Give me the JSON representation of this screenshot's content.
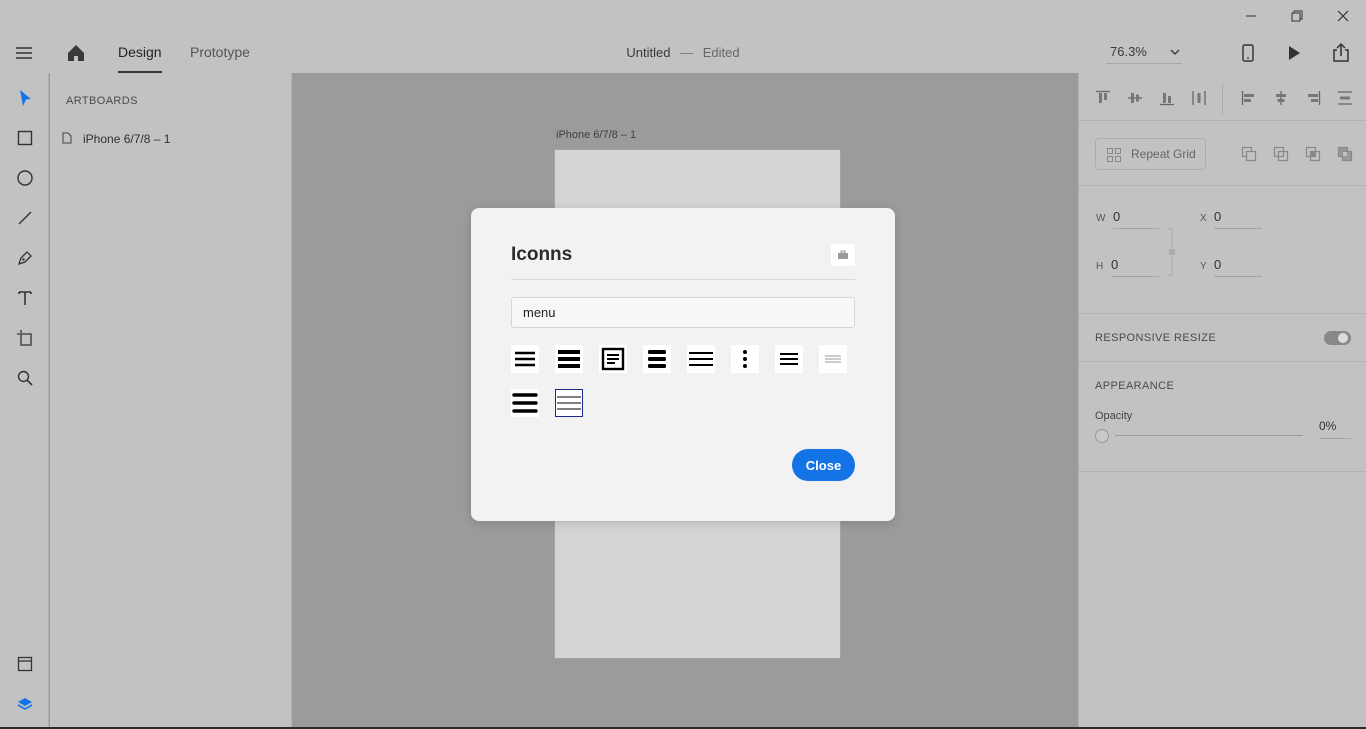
{
  "header": {
    "tabs": [
      {
        "label": "Design"
      },
      {
        "label": "Prototype"
      }
    ],
    "doc_name": "Untitled",
    "doc_separator": "—",
    "doc_status": "Edited",
    "zoom": "76.3%"
  },
  "layers": {
    "heading": "ARTBOARDS",
    "items": [
      {
        "label": "iPhone 6/7/8 – 1"
      }
    ]
  },
  "canvas": {
    "artboard_label": "iPhone 6/7/8 – 1"
  },
  "properties": {
    "repeat_grid_label": "Repeat Grid",
    "w_label": "W",
    "w_value": "0",
    "h_label": "H",
    "h_value": "0",
    "x_label": "X",
    "x_value": "0",
    "y_label": "Y",
    "y_value": "0",
    "responsive_resize_label": "RESPONSIVE RESIZE",
    "responsive_resize_on": true,
    "appearance_heading": "APPEARANCE",
    "opacity_label": "Opacity",
    "opacity_value": "0%"
  },
  "dialog": {
    "title": "Iconns",
    "search_value": "menu",
    "close_label": "Close",
    "results": [
      {
        "icon": "hamburger-menu-icon"
      },
      {
        "icon": "thick-hamburger-menu-icon"
      },
      {
        "icon": "boxed-menu-icon"
      },
      {
        "icon": "bold-menu-icon"
      },
      {
        "icon": "thin-menu-icon"
      },
      {
        "icon": "kebab-menu-icon"
      },
      {
        "icon": "narrow-menu-icon"
      },
      {
        "icon": "light-menu-icon"
      },
      {
        "icon": "rounded-menu-icon"
      },
      {
        "icon": "outline-menu-icon",
        "selected": true
      }
    ]
  },
  "colors": {
    "accent": "#1473e6",
    "chrome": "#c2c2c2",
    "canvas": "#9b9b9b",
    "selected_outline": "#1a2a8a"
  }
}
